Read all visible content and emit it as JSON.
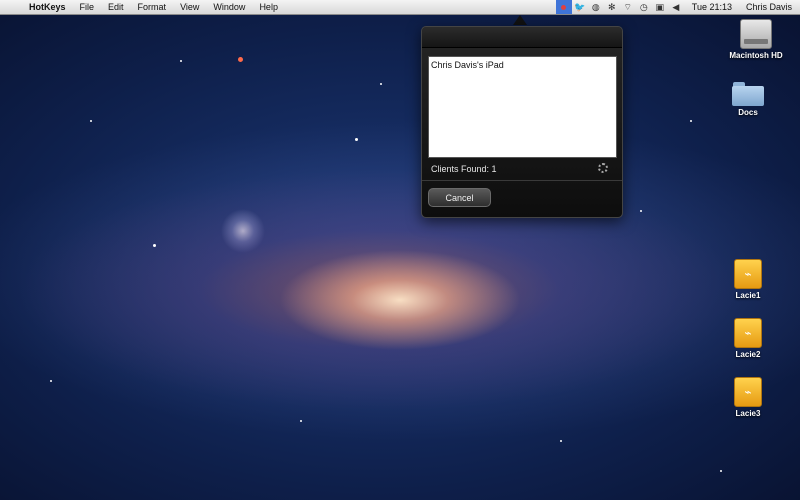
{
  "menubar": {
    "app_name": "HotKeys",
    "items": [
      "File",
      "Edit",
      "Format",
      "View",
      "Window",
      "Help"
    ],
    "status_icons": [
      "hotkeys-status-icon",
      "twitter-icon",
      "globe-icon",
      "pinwheel-icon",
      "wifi-icon",
      "time-machine-icon",
      "display-icon",
      "volume-icon"
    ],
    "clock": "Tue 21:13",
    "user": "Chris Davis"
  },
  "popover": {
    "clients": [
      "Chris Davis's iPad"
    ],
    "clients_found_label": "Clients Found:",
    "clients_found_count": "1",
    "cancel_label": "Cancel"
  },
  "desktop": {
    "icons": [
      {
        "label": "Macintosh HD",
        "type": "hard-drive-icon"
      },
      {
        "label": "Docs",
        "type": "folder-icon"
      },
      {
        "label": "Lacie1",
        "type": "usb-drive-icon"
      },
      {
        "label": "Lacie2",
        "type": "usb-drive-icon"
      },
      {
        "label": "Lacie3",
        "type": "usb-drive-icon"
      }
    ]
  }
}
